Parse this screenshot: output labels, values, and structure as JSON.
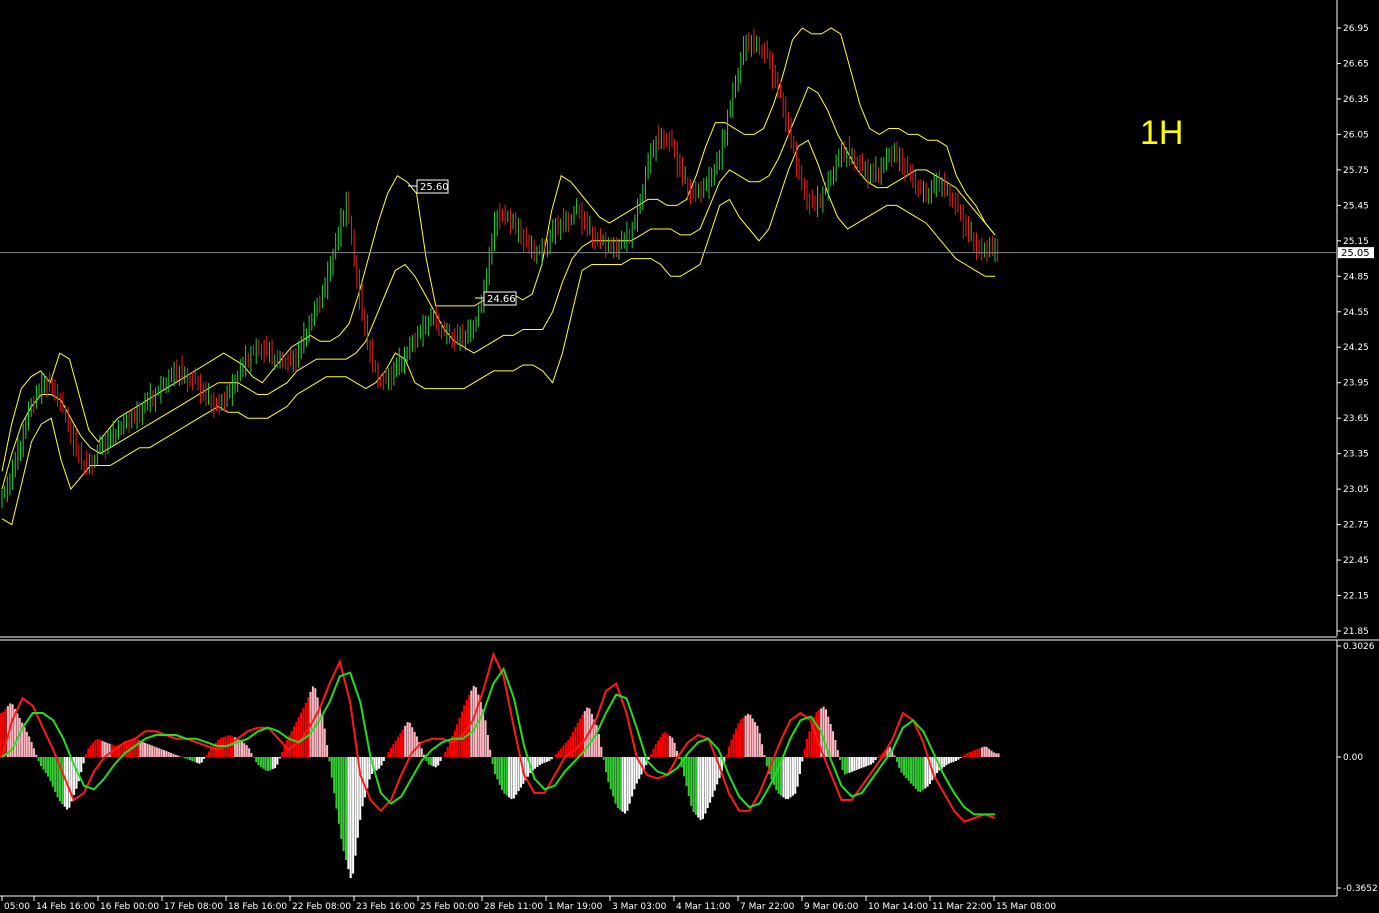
{
  "window": {
    "timeframe_label": "1H",
    "current_price": "25.05"
  },
  "colors": {
    "background": "#000000",
    "candle_bull": "#2ecc40",
    "candle_bear": "#e0261f",
    "bands": "#ffff33",
    "axis_text": "#ffffff",
    "macd_fast": "#ff1a1a",
    "macd_signal": "#22dd22",
    "hist_pos_strong": "#ff0000",
    "hist_pos_weak": "#ffb6c1",
    "hist_neg_strong": "#33cc33",
    "hist_neg_weak": "#ffffff"
  },
  "price_axis": {
    "ticks": [
      "26.95",
      "26.65",
      "26.35",
      "26.05",
      "25.75",
      "25.45",
      "25.15",
      "24.85",
      "24.55",
      "24.25",
      "23.95",
      "23.65",
      "23.35",
      "23.05",
      "22.75",
      "22.45",
      "22.15",
      "21.85"
    ]
  },
  "indicator_axis": {
    "ticks": [
      "0.3026",
      "0.00",
      "-0.3652"
    ]
  },
  "time_axis": {
    "ticks": [
      "05:00",
      "14 Feb 16:00",
      "16 Feb 00:00",
      "17 Feb 08:00",
      "18 Feb 16:00",
      "22 Feb 08:00",
      "23 Feb 16:00",
      "25 Feb 00:00",
      "28 Feb 11:00",
      "1 Mar 19:00",
      "3 Mar 03:00",
      "4 Mar 11:00",
      "7 Mar 22:00",
      "9 Mar 06:00",
      "10 Mar 14:00",
      "11 Mar 22:00",
      "15 Mar 08:00"
    ]
  },
  "annotations": {
    "high1": "25.60",
    "high2": "24.66"
  },
  "chart_data": [
    {
      "type": "line",
      "title": "",
      "description_units": "price",
      "ylim": [
        21.85,
        27.0
      ],
      "x_index_range": [
        0,
        159
      ],
      "series": [
        {
          "name": "",
          "role": "close",
          "values": [
            23.0,
            23.2,
            23.45,
            23.7,
            23.85,
            23.95,
            23.9,
            23.8,
            23.6,
            23.35,
            23.25,
            23.3,
            23.4,
            23.45,
            23.55,
            23.6,
            23.65,
            23.7,
            23.8,
            23.85,
            23.95,
            24.0,
            24.05,
            24.0,
            23.95,
            23.85,
            23.8,
            23.75,
            23.85,
            23.95,
            24.1,
            24.2,
            24.25,
            24.2,
            24.15,
            24.15,
            24.1,
            24.2,
            24.4,
            24.55,
            24.7,
            24.95,
            25.2,
            25.5,
            25.0,
            24.5,
            24.2,
            24.0,
            23.95,
            24.05,
            24.15,
            24.25,
            24.35,
            24.45,
            24.5,
            24.4,
            24.35,
            24.3,
            24.35,
            24.45,
            24.6,
            25.0,
            25.4,
            25.35,
            25.3,
            25.2,
            25.1,
            25.05,
            25.1,
            25.2,
            25.3,
            25.35,
            25.4,
            25.3,
            25.2,
            25.15,
            25.1,
            25.1,
            25.15,
            25.25,
            25.5,
            25.8,
            26.0,
            26.05,
            25.95,
            25.75,
            25.6,
            25.55,
            25.6,
            25.7,
            25.85,
            26.2,
            26.5,
            26.75,
            26.85,
            26.8,
            26.7,
            26.5,
            26.3,
            26.0,
            25.7,
            25.5,
            25.45,
            25.55,
            25.7,
            25.85,
            25.9,
            25.85,
            25.75,
            25.7,
            25.75,
            25.85,
            25.9,
            25.8,
            25.7,
            25.6,
            25.55,
            25.6,
            25.65,
            25.55,
            25.4,
            25.25,
            25.15,
            25.05,
            25.1,
            25.05
          ]
        },
        {
          "name": "",
          "role": "upper_band",
          "values": [
            23.2,
            23.6,
            23.9,
            24.0,
            24.05,
            23.95,
            24.2,
            24.15,
            23.85,
            23.55,
            23.45,
            23.55,
            23.65,
            23.7,
            23.75,
            23.8,
            23.85,
            23.9,
            23.95,
            24.0,
            24.05,
            24.1,
            24.15,
            24.2,
            24.15,
            24.1,
            24.0,
            23.95,
            24.05,
            24.15,
            24.25,
            24.3,
            24.35,
            24.3,
            24.3,
            24.35,
            24.45,
            24.7,
            25.0,
            25.3,
            25.55,
            25.7,
            25.65,
            25.55,
            25.0,
            24.6,
            24.6,
            24.6,
            24.6,
            24.6,
            24.65,
            24.7,
            24.7,
            24.7,
            24.65,
            24.7,
            24.95,
            25.4,
            25.7,
            25.65,
            25.55,
            25.45,
            25.35,
            25.3,
            25.35,
            25.4,
            25.45,
            25.5,
            25.5,
            25.45,
            25.45,
            25.5,
            25.7,
            25.95,
            26.15,
            26.15,
            26.1,
            26.05,
            26.05,
            26.1,
            26.3,
            26.55,
            26.85,
            26.95,
            26.9,
            26.9,
            26.95,
            26.9,
            26.6,
            26.3,
            26.1,
            26.05,
            26.1,
            26.1,
            26.05,
            26.05,
            26.0,
            26.0,
            25.95,
            25.7,
            25.55,
            25.45,
            25.3,
            25.2
          ]
        },
        {
          "name": "",
          "role": "middle_band",
          "values": [
            23.05,
            23.35,
            23.6,
            23.75,
            23.85,
            23.85,
            23.8,
            23.65,
            23.5,
            23.4,
            23.35,
            23.4,
            23.45,
            23.5,
            23.55,
            23.6,
            23.65,
            23.7,
            23.75,
            23.8,
            23.85,
            23.9,
            23.95,
            23.95,
            23.95,
            23.9,
            23.85,
            23.85,
            23.9,
            23.95,
            24.05,
            24.1,
            24.15,
            24.15,
            24.15,
            24.15,
            24.2,
            24.3,
            24.5,
            24.7,
            24.9,
            24.95,
            24.85,
            24.7,
            24.55,
            24.4,
            24.3,
            24.25,
            24.2,
            24.25,
            24.3,
            24.35,
            24.35,
            24.4,
            24.4,
            24.4,
            24.55,
            24.8,
            25.0,
            25.1,
            25.15,
            25.15,
            25.15,
            25.15,
            25.15,
            25.2,
            25.25,
            25.25,
            25.25,
            25.2,
            25.2,
            25.25,
            25.45,
            25.65,
            25.75,
            25.7,
            25.65,
            25.65,
            25.7,
            25.85,
            26.05,
            26.25,
            26.45,
            26.4,
            26.25,
            26.05,
            25.9,
            25.75,
            25.65,
            25.6,
            25.6,
            25.65,
            25.7,
            25.75,
            25.75,
            25.7,
            25.65,
            25.6,
            25.5,
            25.4,
            25.3,
            25.2
          ]
        },
        {
          "name": "",
          "role": "lower_band",
          "values": [
            22.8,
            22.75,
            23.1,
            23.45,
            23.6,
            23.65,
            23.3,
            23.05,
            23.15,
            23.25,
            23.25,
            23.25,
            23.3,
            23.35,
            23.4,
            23.4,
            23.45,
            23.5,
            23.55,
            23.6,
            23.65,
            23.7,
            23.75,
            23.7,
            23.7,
            23.65,
            23.65,
            23.65,
            23.7,
            23.75,
            23.85,
            23.9,
            23.95,
            24.0,
            24.0,
            24.0,
            23.95,
            23.9,
            23.95,
            24.05,
            24.2,
            24.15,
            23.95,
            23.9,
            23.9,
            23.9,
            23.9,
            23.9,
            23.95,
            24.0,
            24.05,
            24.05,
            24.05,
            24.1,
            24.1,
            24.05,
            23.95,
            24.2,
            24.55,
            24.9,
            24.95,
            24.95,
            24.95,
            24.95,
            25.0,
            25.0,
            25.0,
            24.95,
            24.85,
            24.85,
            24.9,
            24.95,
            25.2,
            25.45,
            25.5,
            25.35,
            25.25,
            25.15,
            25.25,
            25.5,
            25.75,
            25.95,
            26.0,
            25.8,
            25.55,
            25.35,
            25.25,
            25.3,
            25.35,
            25.4,
            25.45,
            25.45,
            25.4,
            25.35,
            25.3,
            25.2,
            25.1,
            25.0,
            24.95,
            24.9,
            24.85,
            24.85
          ]
        }
      ]
    },
    {
      "type": "bar",
      "title": "",
      "ylim": [
        -0.3652,
        0.3026
      ],
      "series": [
        {
          "name": "",
          "role": "histogram",
          "values": [
            0.12,
            0.15,
            0.1,
            0.05,
            -0.02,
            -0.06,
            -0.12,
            -0.15,
            -0.08,
            0.02,
            0.05,
            0.04,
            0.03,
            0.04,
            0.05,
            0.04,
            0.03,
            0.02,
            0.01,
            0.0,
            -0.01,
            -0.02,
            0.02,
            0.05,
            0.06,
            0.05,
            0.03,
            -0.02,
            -0.04,
            -0.03,
            0.04,
            0.09,
            0.14,
            0.2,
            0.1,
            -0.08,
            -0.25,
            -0.35,
            -0.15,
            -0.05,
            -0.03,
            0.02,
            0.06,
            0.1,
            0.05,
            -0.02,
            -0.03,
            0.02,
            0.08,
            0.15,
            0.2,
            0.12,
            -0.04,
            -0.1,
            -0.12,
            -0.08,
            -0.04,
            -0.02,
            -0.01,
            0.02,
            0.05,
            0.1,
            0.14,
            0.08,
            -0.06,
            -0.14,
            -0.16,
            -0.08,
            -0.03,
            0.03,
            0.07,
            0.05,
            -0.04,
            -0.15,
            -0.18,
            -0.12,
            -0.05,
            0.04,
            0.1,
            0.12,
            0.08,
            -0.04,
            -0.1,
            -0.12,
            -0.1,
            0.04,
            0.12,
            0.14,
            0.06,
            -0.05,
            -0.04,
            -0.03,
            -0.02,
            0.01,
            0.03,
            -0.04,
            -0.07,
            -0.1,
            -0.08,
            -0.04,
            -0.02,
            -0.01,
            0.01,
            0.02,
            0.03,
            0.01
          ]
        },
        {
          "name": "",
          "role": "fast_line",
          "values": [
            0.0,
            0.1,
            0.16,
            0.14,
            0.08,
            0.02,
            -0.05,
            -0.12,
            -0.1,
            -0.04,
            0.0,
            0.02,
            0.04,
            0.05,
            0.07,
            0.07,
            0.06,
            0.05,
            0.05,
            0.04,
            0.03,
            0.02,
            0.03,
            0.05,
            0.07,
            0.08,
            0.08,
            0.05,
            0.02,
            0.04,
            0.08,
            0.13,
            0.2,
            0.26,
            0.15,
            -0.05,
            -0.12,
            -0.15,
            -0.12,
            -0.05,
            0.01,
            0.04,
            0.05,
            0.05,
            0.04,
            0.06,
            0.1,
            0.18,
            0.28,
            0.22,
            0.08,
            -0.05,
            -0.1,
            -0.1,
            -0.05,
            0.0,
            0.02,
            0.05,
            0.1,
            0.18,
            0.2,
            0.12,
            0.0,
            -0.05,
            -0.06,
            -0.05,
            0.0,
            0.04,
            0.06,
            0.05,
            -0.02,
            -0.1,
            -0.15,
            -0.15,
            -0.1,
            -0.03,
            0.04,
            0.1,
            0.12,
            0.1,
            0.02,
            -0.05,
            -0.12,
            -0.12,
            -0.08,
            -0.04,
            0.0,
            0.05,
            0.12,
            0.1,
            0.04,
            -0.05,
            -0.1,
            -0.15,
            -0.18,
            -0.17,
            -0.16,
            -0.17
          ]
        },
        {
          "name": "",
          "role": "signal_line",
          "values": [
            0.0,
            0.02,
            0.08,
            0.12,
            0.12,
            0.1,
            0.05,
            -0.02,
            -0.08,
            -0.09,
            -0.06,
            -0.02,
            0.01,
            0.03,
            0.05,
            0.06,
            0.06,
            0.06,
            0.05,
            0.05,
            0.04,
            0.03,
            0.03,
            0.04,
            0.05,
            0.07,
            0.08,
            0.07,
            0.05,
            0.04,
            0.06,
            0.1,
            0.15,
            0.22,
            0.23,
            0.15,
            0.0,
            -0.1,
            -0.13,
            -0.11,
            -0.06,
            -0.01,
            0.02,
            0.04,
            0.05,
            0.05,
            0.07,
            0.12,
            0.2,
            0.24,
            0.16,
            0.03,
            -0.06,
            -0.09,
            -0.08,
            -0.04,
            -0.01,
            0.02,
            0.06,
            0.12,
            0.17,
            0.16,
            0.08,
            -0.01,
            -0.04,
            -0.05,
            -0.03,
            0.01,
            0.04,
            0.05,
            0.02,
            -0.05,
            -0.11,
            -0.14,
            -0.13,
            -0.08,
            -0.02,
            0.05,
            0.1,
            0.11,
            0.07,
            -0.01,
            -0.08,
            -0.11,
            -0.1,
            -0.06,
            -0.02,
            0.02,
            0.08,
            0.1,
            0.07,
            0.01,
            -0.05,
            -0.1,
            -0.14,
            -0.16,
            -0.16,
            -0.16
          ]
        }
      ]
    }
  ]
}
